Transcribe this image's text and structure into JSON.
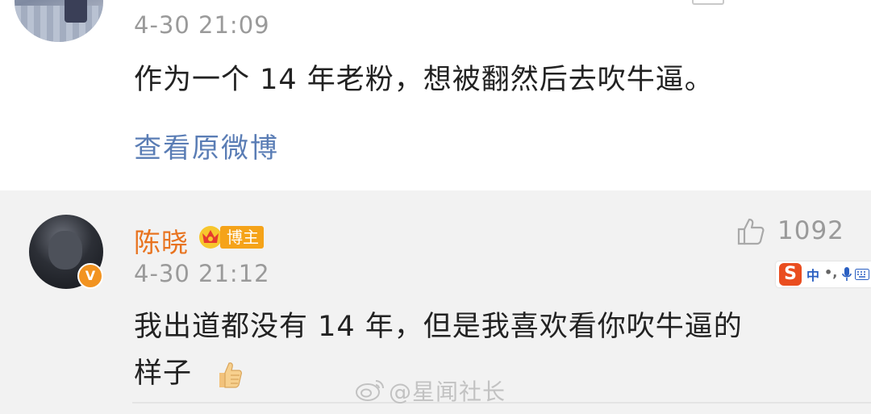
{
  "comment1": {
    "time": "4-30 21:09",
    "text": "作为一个 14 年老粉，想被翻然后去吹牛逼。",
    "view_original": "查看原微博"
  },
  "comment2": {
    "username": "陈晓",
    "badge": "博主",
    "verified_mark": "V",
    "like_count": "1092",
    "time": "4-30 21:12",
    "text_line1": "我出道都没有 14 年，但是我喜欢看你吹牛逼的",
    "text_line2": "样子"
  },
  "ime": {
    "logo": "S",
    "lang": "中",
    "punct": "•,"
  },
  "watermark": "@星闻社长",
  "colors": {
    "username": "#e8731f",
    "link": "#5a7db5",
    "meta": "#9a9a9a",
    "badge": "#f5a319",
    "reply_bg": "#f2f2f2"
  },
  "icons": [
    "thumbs-up-icon",
    "crown-icon",
    "thumbs-up-emoji",
    "weibo-logo-icon",
    "verified-v-icon",
    "ime-logo-icon",
    "mic-icon",
    "keyboard-icon"
  ]
}
